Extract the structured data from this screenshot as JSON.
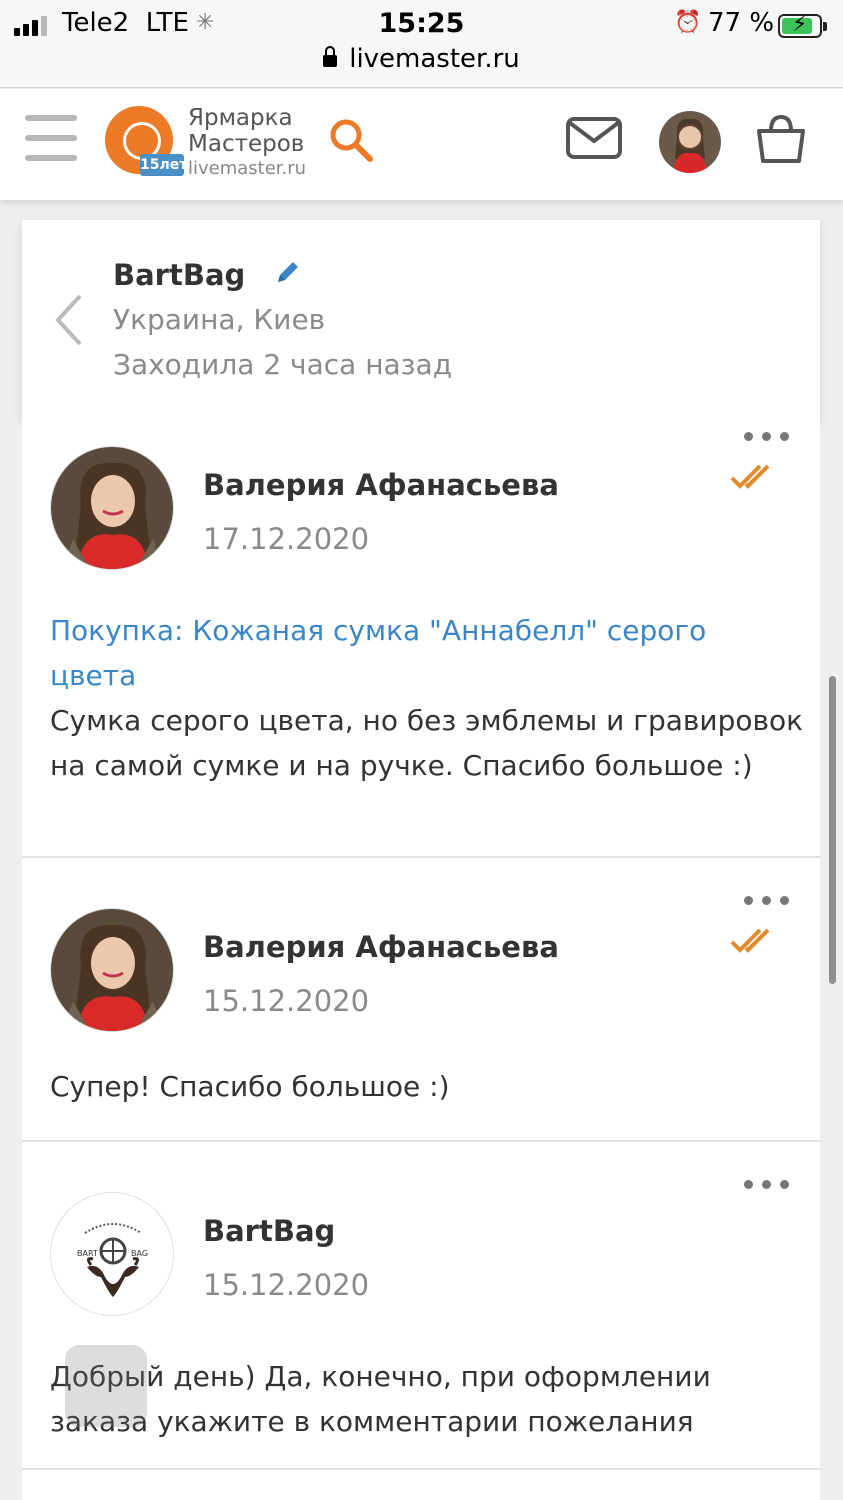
{
  "status_bar": {
    "carrier": "Tele2",
    "network": "LTE",
    "time": "15:25",
    "battery": "77 %",
    "url": "livemaster.ru"
  },
  "header": {
    "logo_line1": "Ярмарка",
    "logo_line2": "Мастеров",
    "logo_badge": "15лет",
    "logo_url": "livemaster.ru",
    "brand_color": "#ec7a26"
  },
  "profile": {
    "name": "BartBag",
    "location": "Украина, Киев",
    "last_seen": "Заходила 2 часа назад"
  },
  "messages": [
    {
      "author": "Валерия Афанасьева",
      "date": "17.12.2020",
      "purchase": "Покупка: Кожаная сумка \"Аннабелл\" серого цвета",
      "text": "Сумка серого цвета, но без эмблемы и гравировок на самой сумке и на ручке. Спасибо большое :)"
    },
    {
      "author": "Валерия Афанасьева",
      "date": "15.12.2020",
      "text": "Супер! Спасибо большое :)"
    },
    {
      "author": "BartBag",
      "date": "15.12.2020",
      "text": "Добрый день) Да, конечно, при оформлении заказа укажите в комментарии пожелания"
    }
  ],
  "colors": {
    "link": "#3a86c8",
    "read_check": "#e5892e",
    "muted_text": "#8a8a8a"
  }
}
